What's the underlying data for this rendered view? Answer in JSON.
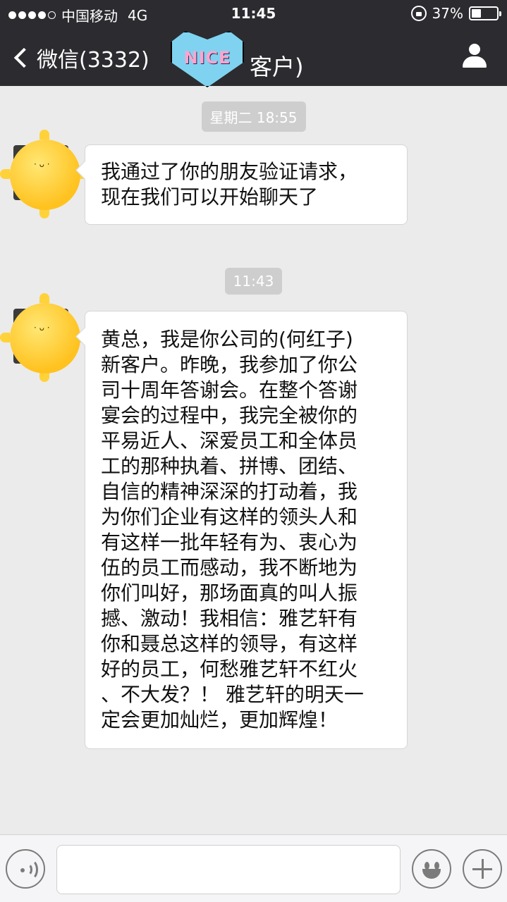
{
  "status_bar": {
    "carrier": "中国移动",
    "network": "4G",
    "time": "11:45",
    "battery_text": "37%",
    "battery_level": 0.37,
    "signal_strength": 4,
    "signal_max": 5
  },
  "nav": {
    "back_label": "微信(3332)",
    "badge_text": "NICE",
    "title_suffix": "客户)",
    "back_icon": "chevron-left-icon",
    "profile_icon": "person-icon"
  },
  "messages": [
    {
      "timestamp": "星期二 18:55",
      "lines": [
        "我通过了你的朋友验证请求，",
        "现在我们可以开始聊天了"
      ]
    },
    {
      "timestamp": "11:43",
      "lines": [
        "黄总，我是你公司的(何红子)",
        "新客户。昨晚，我参加了你公",
        "司十周年答谢会。在整个答谢",
        "宴会的过程中，我完全被你的",
        "平易近人、深爱员工和全体员",
        "工的那种执着、拼博、团结、",
        "自信的精神深深的打动着，我",
        "为你们企业有这样的领头人和",
        "有这样一批年轻有为、衷心为",
        "伍的员工而感动，我不断地为",
        "你们叫好，那场面真的叫人振",
        "撼、激动！我相信：雅艺轩有",
        "你和聂总这样的领导，有这样",
        "好的员工，何愁雅艺轩不红火",
        "、不大发？！ 雅艺轩的明天一",
        "定会更加灿烂，更加辉煌！"
      ]
    }
  ],
  "input_bar": {
    "voice_icon": "voice-icon",
    "emoji_icon": "emoji-icon",
    "plus_icon": "plus-icon",
    "input_value": ""
  },
  "colors": {
    "nav_background": "#2b2b30",
    "chat_background": "#ebebeb",
    "timestamp_background": "#cecece",
    "bubble_background": "#ffffff"
  }
}
